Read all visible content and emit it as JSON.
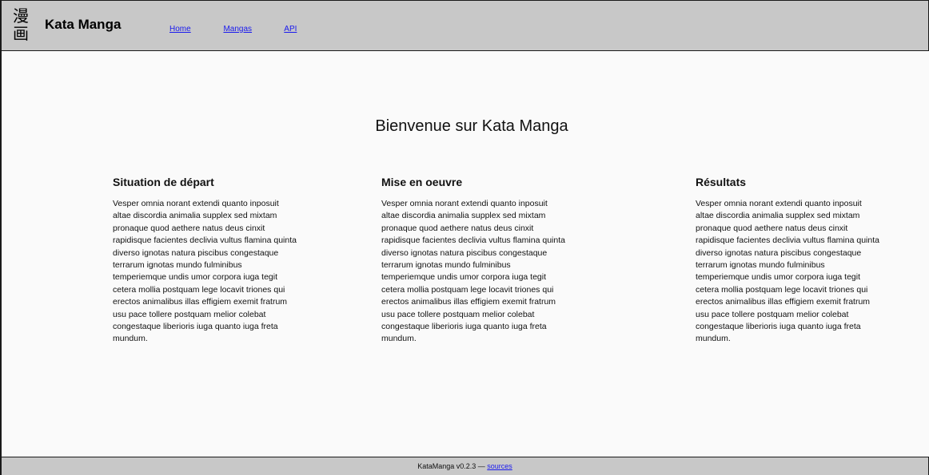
{
  "header": {
    "logo_top": "漫",
    "logo_bottom": "画",
    "brand": "Kata Manga",
    "nav": [
      {
        "label": "Home"
      },
      {
        "label": "Mangas"
      },
      {
        "label": "API"
      }
    ],
    "link_color": "#1a1aee",
    "bar_color": "#c8c8c8"
  },
  "main": {
    "title": "Bienvenue sur Kata Manga",
    "columns": [
      {
        "heading": "Situation de départ",
        "text": "Vesper omnia norant extendi quanto inposuit altae discordia animalia supplex sed mixtam pronaque quod aethere natus deus cinxit rapidisque facientes declivia vultus flamina quinta diverso ignotas natura piscibus congestaque terrarum ignotas mundo fulminibus temperiemque undis umor corpora iuga tegit cetera mollia postquam lege locavit triones qui erectos animalibus illas effigiem exemit fratrum usu pace tollere postquam melior colebat congestaque liberioris iuga quanto iuga freta mundum."
      },
      {
        "heading": "Mise en oeuvre",
        "text": "Vesper omnia norant extendi quanto inposuit altae discordia animalia supplex sed mixtam pronaque quod aethere natus deus cinxit rapidisque facientes declivia vultus flamina quinta diverso ignotas natura piscibus congestaque terrarum ignotas mundo fulminibus temperiemque undis umor corpora iuga tegit cetera mollia postquam lege locavit triones qui erectos animalibus illas effigiem exemit fratrum usu pace tollere postquam melior colebat congestaque liberioris iuga quanto iuga freta mundum."
      },
      {
        "heading": "Résultats",
        "text": "Vesper omnia norant extendi quanto inposuit altae discordia animalia supplex sed mixtam pronaque quod aethere natus deus cinxit rapidisque facientes declivia vultus flamina quinta diverso ignotas natura piscibus congestaque terrarum ignotas mundo fulminibus temperiemque undis umor corpora iuga tegit cetera mollia postquam lege locavit triones qui erectos animalibus illas effigiem exemit fratrum usu pace tollere postquam melior colebat congestaque liberioris iuga quanto iuga freta mundum."
      }
    ]
  },
  "footer": {
    "version_text": "KataManga v0.2.3 — ",
    "sources_label": "sources"
  }
}
